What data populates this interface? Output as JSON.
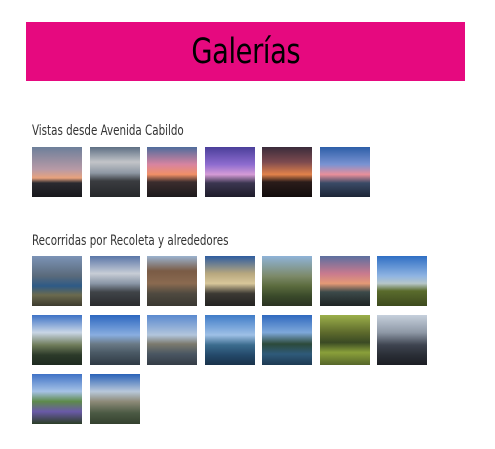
{
  "page": {
    "title": "Galerías",
    "accent": "#e6097f"
  },
  "galleries": [
    {
      "title": "Vistas desde Avenida Cabildo",
      "thumbnails": [
        {
          "bg": "linear-gradient(180deg,#6d7f9a 0%,#b89aa6 45%,#e8a27d 62%,#2a2a30 72%,#18181c 100%)"
        },
        {
          "bg": "linear-gradient(180deg,#5e6f84 0%,#c2c4c8 30%,#8e97a3 52%,#3a3c40 68%,#26272a 100%)"
        },
        {
          "bg": "linear-gradient(180deg,#4f6c9c 0%,#d884a0 35%,#f08f66 55%,#3b2d2e 70%,#1d1a1c 100%)"
        },
        {
          "bg": "linear-gradient(180deg,#4a3f9a 0%,#8e6ccf 35%,#d59bd6 55%,#3b3650 72%,#1e1c2a 100%)"
        },
        {
          "bg": "linear-gradient(180deg,#3a2c3b 0%,#7c4a4f 30%,#e2824a 55%,#2a1c1a 70%,#120c0c 100%)"
        },
        {
          "bg": "linear-gradient(180deg,#2d5fa8 0%,#7a93d2 35%,#e98f9a 55%,#3a4a66 72%,#1d2536 100%)"
        }
      ]
    },
    {
      "title": "Recorridas por Recoleta y alrededores",
      "thumbnails": [
        {
          "bg": "linear-gradient(180deg,#7c93b6 0%,#5a6a7a 40%,#2e5a86 60%,#6b6a4e 78%,#3d3b2e 100%)"
        },
        {
          "bg": "linear-gradient(180deg,#5b76a8 0%,#c7cdd6 35%,#8a96a6 55%,#404448 72%,#2a2b2e 100%)"
        },
        {
          "bg": "linear-gradient(180deg,#9bb3cf 0%,#7a5b45 30%,#8a6a50 55%,#4f4a40 75%,#3a3832 100%)"
        },
        {
          "bg": "linear-gradient(180deg,#2f5da0 0%,#b7a77e 35%,#d8c79a 55%,#3c3a34 75%,#242322 100%)"
        },
        {
          "bg": "linear-gradient(180deg,#8fb3d8 0%,#7d8a6a 40%,#5b6b3e 60%,#3a4a2a 80%,#2b3322 100%)"
        },
        {
          "bg": "linear-gradient(180deg,#5d6fa0 0%,#c87a8e 35%,#e59a76 55%,#3c4a4a 72%,#1f2424 100%)"
        },
        {
          "bg": "linear-gradient(180deg,#2f6fc4 0%,#8fb4e2 40%,#b6c6c8 55%,#5a6b2c 70%,#3d4a1e 100%)"
        },
        {
          "bg": "linear-gradient(180deg,#3d72c6 0%,#c9d6e6 35%,#6f7c5a 60%,#2c3a2a 80%,#1e2a20 100%)"
        },
        {
          "bg": "linear-gradient(180deg,#2c67c0 0%,#89aee0 40%,#6a7a86 58%,#4b5a66 75%,#2f3a44 100%)"
        },
        {
          "bg": "linear-gradient(180deg,#5a8acf 0%,#b2c6dc 40%,#7c7a6e 58%,#4a5662 78%,#343c46 100%)"
        },
        {
          "bg": "linear-gradient(180deg,#3f7cc8 0%,#9ec0e6 40%,#3b6c8e 60%,#24496a 80%,#1a324a 100%)"
        },
        {
          "bg": "linear-gradient(180deg,#2f69bf 0%,#7ea8da 35%,#2c4a3a 58%,#2f5a7a 78%,#1e3a52 100%)"
        },
        {
          "bg": "linear-gradient(180deg,#9cb04a 0%,#5d6a2c 35%,#3a4a24 55%,#8aa03a 75%,#56662a 100%)"
        },
        {
          "bg": "linear-gradient(180deg,#c6d0dc 0%,#8e98a6 35%,#3e4450 60%,#2a2e36 80%,#1c1e24 100%)"
        },
        {
          "bg": "linear-gradient(180deg,#3f72c6 0%,#a6c2e6 35%,#5d8a4a 55%,#6a5aa8 75%,#2c3e26 100%)"
        },
        {
          "bg": "linear-gradient(180deg,#2a62b8 0%,#b8c8da 35%,#8d8a78 55%,#4b5a44 78%,#34402e 100%)"
        }
      ]
    }
  ]
}
